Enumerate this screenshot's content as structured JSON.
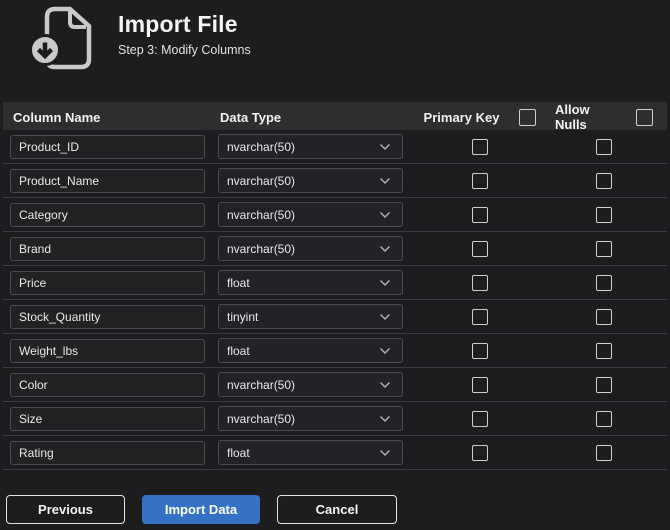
{
  "header": {
    "title": "Import File",
    "subtitle": "Step 3: Modify Columns"
  },
  "icons": {
    "header_icon": "file-import-icon",
    "dropdown_icon": "chevron-down-icon"
  },
  "table": {
    "columns": [
      "Column Name",
      "Data Type",
      "Primary Key",
      "Allow Nulls"
    ],
    "header_checkboxes": {
      "primary_key_all": false,
      "allow_nulls_all": false
    },
    "rows": [
      {
        "name": "Product_ID",
        "type": "nvarchar(50)",
        "primary_key": false,
        "allow_nulls": false
      },
      {
        "name": "Product_Name",
        "type": "nvarchar(50)",
        "primary_key": false,
        "allow_nulls": false
      },
      {
        "name": "Category",
        "type": "nvarchar(50)",
        "primary_key": false,
        "allow_nulls": false
      },
      {
        "name": "Brand",
        "type": "nvarchar(50)",
        "primary_key": false,
        "allow_nulls": false
      },
      {
        "name": "Price",
        "type": "float",
        "primary_key": false,
        "allow_nulls": false
      },
      {
        "name": "Stock_Quantity",
        "type": "tinyint",
        "primary_key": false,
        "allow_nulls": false
      },
      {
        "name": "Weight_lbs",
        "type": "float",
        "primary_key": false,
        "allow_nulls": false
      },
      {
        "name": "Color",
        "type": "nvarchar(50)",
        "primary_key": false,
        "allow_nulls": false
      },
      {
        "name": "Size",
        "type": "nvarchar(50)",
        "primary_key": false,
        "allow_nulls": false
      },
      {
        "name": "Rating",
        "type": "float",
        "primary_key": false,
        "allow_nulls": false
      }
    ]
  },
  "footer": {
    "previous": "Previous",
    "import": "Import Data",
    "cancel": "Cancel"
  },
  "colors": {
    "background": "#1d1d1f",
    "header_row_bg": "#2e2e31",
    "accent_blue": "#3572c6",
    "field_border": "#4c4c50",
    "row_separator": "#3b3b40",
    "checkbox_border": "#cfcfcf"
  }
}
